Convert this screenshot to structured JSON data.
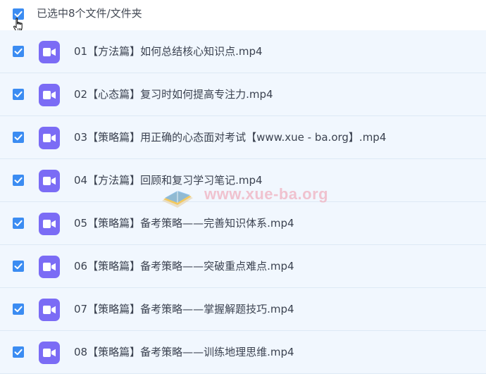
{
  "header": {
    "selection_label": "已选中8个文件/文件夹",
    "all_checked": true
  },
  "files": [
    {
      "name": "01【方法篇】如何总结核心知识点.mp4",
      "checked": true,
      "icon": "video-file-icon"
    },
    {
      "name": "02【心态篇】复习时如何提高专注力.mp4",
      "checked": true,
      "icon": "video-file-icon"
    },
    {
      "name": "03【策略篇】用正确的心态面对考试【www.xue - ba.org】.mp4",
      "checked": true,
      "icon": "video-file-icon"
    },
    {
      "name": "04【方法篇】回顾和复习学习笔记.mp4",
      "checked": true,
      "icon": "video-file-icon"
    },
    {
      "name": "05【策略篇】备考策略——完善知识体系.mp4",
      "checked": true,
      "icon": "video-file-icon"
    },
    {
      "name": "06【策略篇】备考策略——突破重点难点.mp4",
      "checked": true,
      "icon": "video-file-icon"
    },
    {
      "name": "07【策略篇】备考策略——掌握解题技巧.mp4",
      "checked": true,
      "icon": "video-file-icon"
    },
    {
      "name": "08【策略篇】备考策略——训练地理思维.mp4",
      "checked": true,
      "icon": "video-file-icon"
    }
  ],
  "watermark": {
    "text": "www.xue-ba.org"
  },
  "colors": {
    "checkbox": "#3b8cf2",
    "file_icon": "#7b6cf5",
    "row_background": "#f1f7fe",
    "row_divider": "#dde9f5"
  }
}
